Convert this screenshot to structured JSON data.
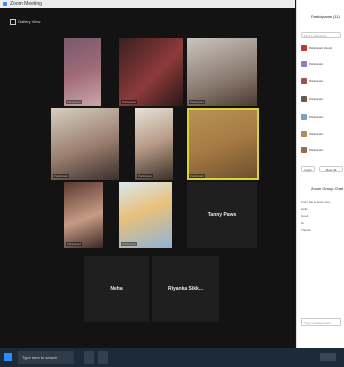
{
  "window": {
    "title": "Zoom Meeting"
  },
  "toolbar": {
    "view_label": "Gallery View"
  },
  "gallery": {
    "tiles": [
      {
        "name": "Participant"
      },
      {
        "name": "Participant"
      },
      {
        "name": "Participant"
      },
      {
        "name": "Participant"
      },
      {
        "name": "Participant"
      },
      {
        "name": "Participant"
      },
      {
        "name": "Participant"
      },
      {
        "name": "Participant"
      },
      {
        "name": "Tanny Paws"
      },
      {
        "name": "Neha"
      },
      {
        "name": "Riyanka Sikk..."
      }
    ]
  },
  "participants_panel": {
    "title": "Participants (11)",
    "search_placeholder": "Find a participant",
    "items": [
      {
        "name": "Participant (Host)",
        "color": "#c0392b"
      },
      {
        "name": "Participant",
        "color": "#8e7cc3"
      },
      {
        "name": "Participant",
        "color": "#a05050"
      },
      {
        "name": "Participant",
        "color": "#6b5b4a"
      },
      {
        "name": "Participant",
        "color": "#7aa0c0"
      },
      {
        "name": "Participant",
        "color": "#b58a5a"
      },
      {
        "name": "Participant",
        "color": "#9b6a4a"
      }
    ],
    "invite_label": "Invite",
    "mute_all_label": "Mute All"
  },
  "chat": {
    "title": "Zoom Group Chat",
    "messages": [
      "From Me to Everyone:",
      "Hello",
      "Good",
      "Hi",
      "Thanks"
    ],
    "input_placeholder": "Type message here..."
  },
  "taskbar": {
    "search_placeholder": "Type here to search"
  }
}
